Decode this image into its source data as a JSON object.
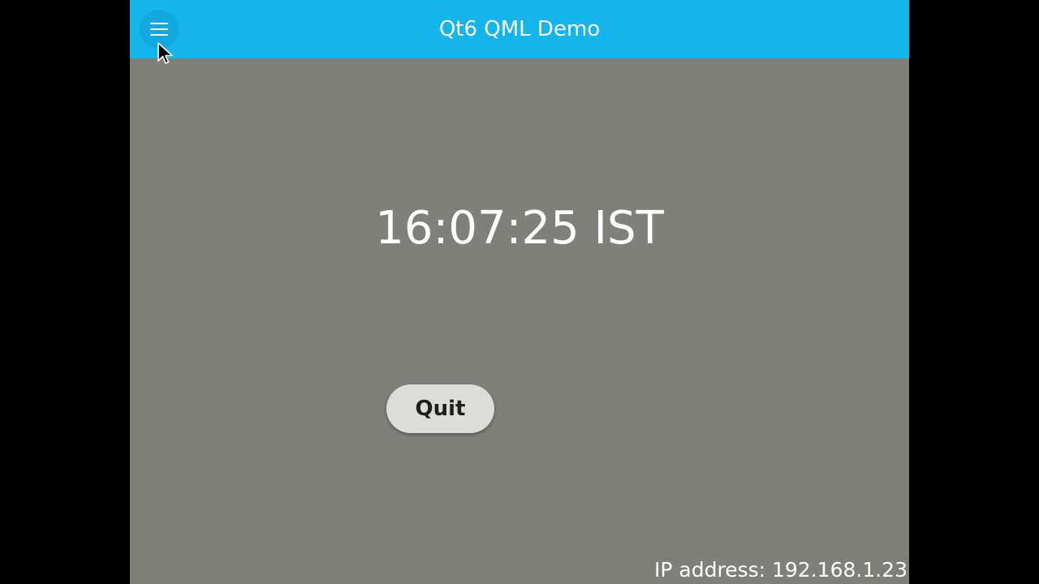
{
  "header": {
    "title": "Qt6 QML Demo",
    "menu_icon": "hamburger-menu-icon",
    "background_color": "#14b4ec"
  },
  "main": {
    "clock_text": "16:07:25 IST",
    "quit_label": "Quit",
    "background_color": "#80807b"
  },
  "footer": {
    "ip_address_text": "IP address: 192.168.1.23"
  },
  "cursor": {
    "icon": "mouse-pointer-icon"
  }
}
